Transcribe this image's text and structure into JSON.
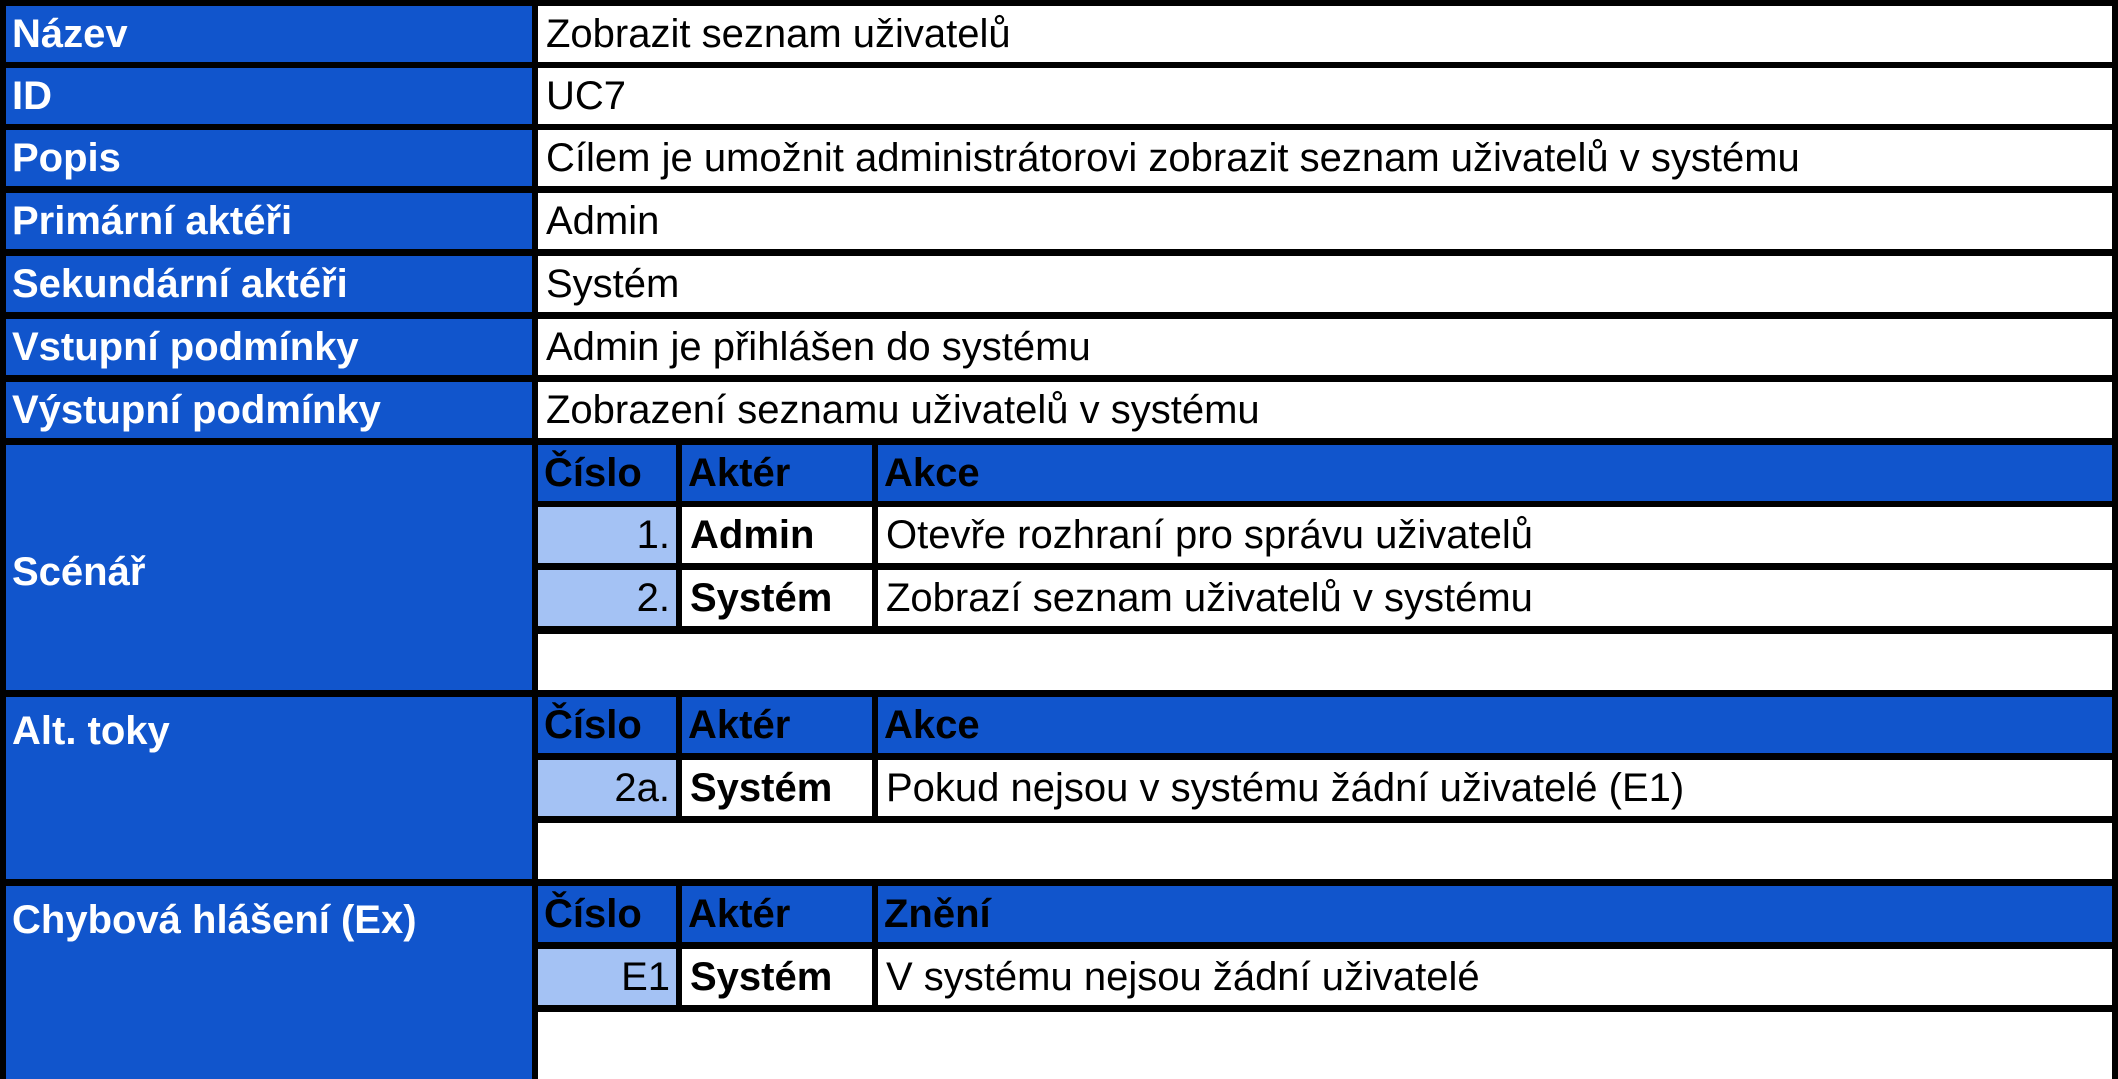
{
  "rows": [
    {
      "label": "Název",
      "value": "Zobrazit seznam uživatelů"
    },
    {
      "label": "ID",
      "value": "UC7"
    },
    {
      "label": "Popis",
      "value": "Cílem je umožnit administrátorovi zobrazit seznam uživatelů v systému"
    },
    {
      "label": "Primární aktéři",
      "value": "Admin"
    },
    {
      "label": "Sekundární aktéři",
      "value": "Systém"
    },
    {
      "label": "Vstupní podmínky",
      "value": "Admin je přihlášen do systému"
    },
    {
      "label": "Výstupní podmínky",
      "value": "Zobrazení seznamu uživatelů v systému"
    }
  ],
  "scenario": {
    "label": "Scénář",
    "headers": [
      "Číslo",
      "Aktér",
      "Akce"
    ],
    "steps": [
      {
        "num": "1.",
        "actor": "Admin",
        "text": "Otevře rozhraní pro správu uživatelů"
      },
      {
        "num": "2.",
        "actor": "Systém",
        "text": "Zobrazí seznam uživatelů v systému"
      }
    ]
  },
  "alt": {
    "label": "Alt. toky",
    "headers": [
      "Číslo",
      "Aktér",
      "Akce"
    ],
    "steps": [
      {
        "num": "2a.",
        "actor": "Systém",
        "text": "Pokud nejsou v systému žádní uživatelé (E1)"
      }
    ]
  },
  "errors": {
    "label": "Chybová hlášení (Ex)",
    "headers": [
      "Číslo",
      "Aktér",
      "Znění"
    ],
    "steps": [
      {
        "num": "E1",
        "actor": "Systém",
        "text": "V systému nejsou žádní uživatelé"
      }
    ]
  },
  "colors": {
    "label_bg": "#1155CC",
    "number_bg": "#A4C2F4",
    "grid": "#000000"
  }
}
